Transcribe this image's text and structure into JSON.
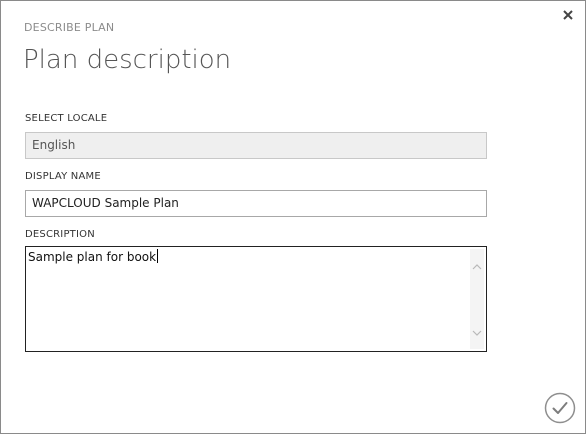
{
  "dialog": {
    "subtitle": "DESCRIBE PLAN",
    "title": "Plan description"
  },
  "locale": {
    "label": "SELECT LOCALE",
    "value": "English"
  },
  "display_name": {
    "label": "DISPLAY NAME",
    "value": "WAPCLOUD Sample Plan"
  },
  "description": {
    "label": "DESCRIPTION",
    "value": "Sample plan for book"
  },
  "icons": {
    "close": "close-icon",
    "confirm": "checkmark-icon",
    "scroll_up": "chevron-up-icon",
    "scroll_down": "chevron-down-icon"
  },
  "colors": {
    "border": "#8a8a8a",
    "label_gray": "#8c8c8c",
    "title_gray": "#555555",
    "disabled_bg": "#efefef"
  }
}
